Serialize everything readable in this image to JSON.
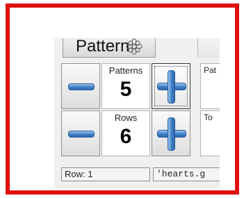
{
  "header": {
    "title": "Pattern",
    "icon": "flower-pattern-icon"
  },
  "patterns": {
    "label": "Patterns",
    "value": "5"
  },
  "rows": {
    "label": "Rows",
    "value": "6"
  },
  "side": {
    "top_label": "Pat",
    "bottom_label": "To"
  },
  "status": {
    "row_text": "Row: 1",
    "file_text": "'hearts.g"
  },
  "colors": {
    "frame": "#e01010",
    "button_blue": "#3d7fc6"
  }
}
